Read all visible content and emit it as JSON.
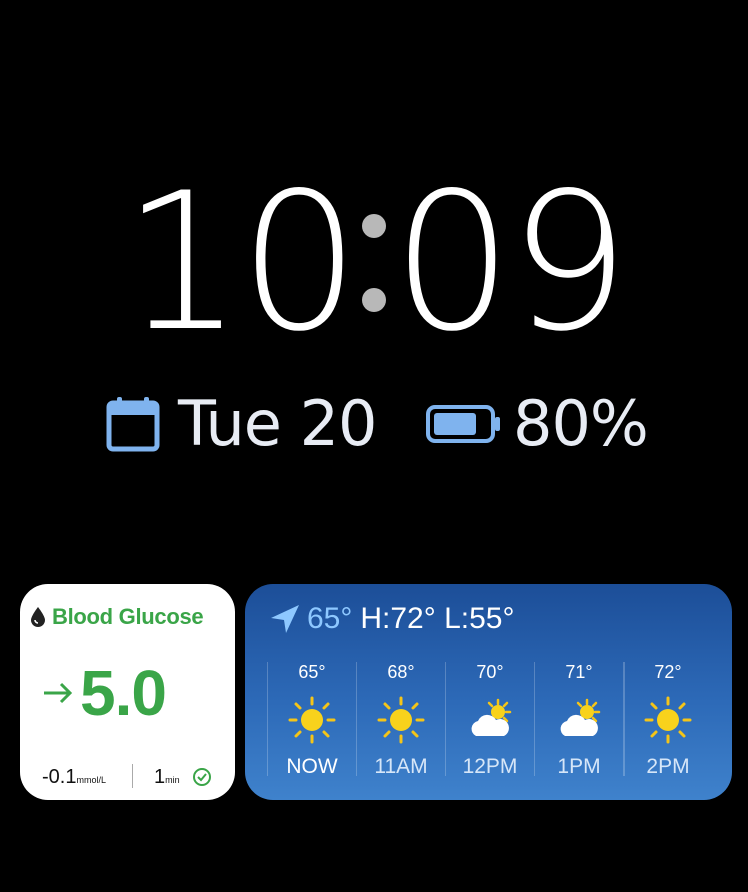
{
  "clock": {
    "hours": "10",
    "minutes": "09"
  },
  "info": {
    "date": "Tue 20",
    "battery": "80%",
    "battery_level": 0.8
  },
  "glucose": {
    "title": "Blood Glucose",
    "value": "5.0",
    "trend": "→",
    "delta": "-0.1",
    "delta_unit": "mmol/L",
    "age": "1",
    "age_unit": "min",
    "accent": "#3aa548"
  },
  "weather": {
    "current": "65°",
    "high_low": "H:72° L:55°",
    "hours": [
      {
        "temp": "65°",
        "time": "NOW",
        "icon": "sun-icon"
      },
      {
        "temp": "68°",
        "time": "11AM",
        "icon": "sun-icon"
      },
      {
        "temp": "70°",
        "time": "12PM",
        "icon": "partly-cloudy-icon"
      },
      {
        "temp": "71°",
        "time": "1PM",
        "icon": "partly-cloudy-icon"
      },
      {
        "temp": "72°",
        "time": "2PM",
        "icon": "sun-icon"
      }
    ]
  }
}
